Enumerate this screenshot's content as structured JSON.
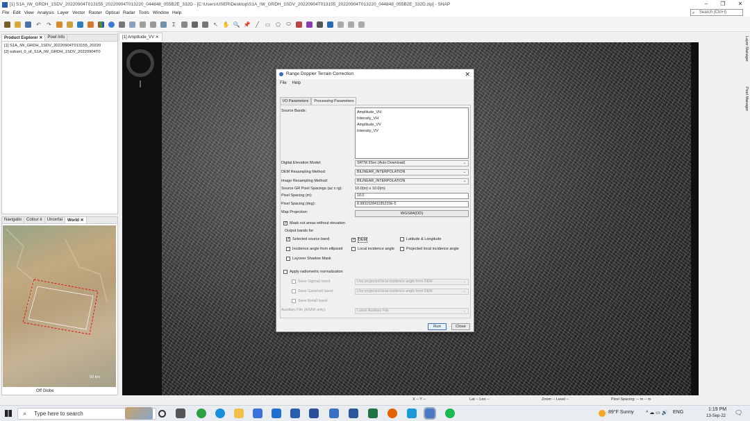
{
  "window": {
    "title": "[1] S1A_IW_GRDH_1SDV_20220904T013155_20220904T013220_044848_055B2E_332D - [C:\\Users\\USER\\Desktop\\S1A_IW_GRDH_1SDV_20220904T013155_20220904T013220_044848_055B2E_332D.zip] - SNAP"
  },
  "menu": [
    "File",
    "Edit",
    "View",
    "Analysis",
    "Layer",
    "Vector",
    "Raster",
    "Optical",
    "Radar",
    "Tools",
    "Window",
    "Help"
  ],
  "search": {
    "placeholder": "Search (Ctrl+I)"
  },
  "product_explorer": {
    "tabs": [
      "Product Explorer",
      "Pixel Info"
    ],
    "items": [
      "[1] S1A_IW_GRDH_1SDV_20220904T013155_20220",
      "[2] subset_0_of_S1A_IW_GRDH_1SDV_20220904T0"
    ]
  },
  "nav_panel": {
    "tabs": [
      "Navigatio",
      "Colour é",
      "Uncertai",
      "World"
    ],
    "footer": "Off Globe",
    "scale": "50 km"
  },
  "document_tab": {
    "label": "[1] Amplitude_VV"
  },
  "dialog": {
    "title": "Range Doppler Terrain Correction",
    "menu": [
      "File",
      "Help"
    ],
    "tabs": [
      "I/O Parameters",
      "Processing Parameters"
    ],
    "source_bands_label": "Source Bands:",
    "source_bands": [
      "Amplitude_VH",
      "Intensity_VH",
      "Amplitude_VV",
      "Intensity_VV"
    ],
    "dem_label": "Digital Elevation Model:",
    "dem_value": "SRTM 3Sec (Auto Download)",
    "dem_resampling_label": "DEM Resampling Method:",
    "dem_resampling_value": "BILINEAR_INTERPOLATION",
    "img_resampling_label": "Image Resampling Method:",
    "img_resampling_value": "BILINEAR_INTERPOLATION",
    "src_spacing_label": "Source GR Pixel Spacings (az x rg):",
    "src_spacing_value": "10.0(m) x 10.0(m)",
    "pixel_spacing_m_label": "Pixel Spacing (m):",
    "pixel_spacing_m_value": "10.0",
    "pixel_spacing_deg_label": "Pixel Spacing (deg):",
    "pixel_spacing_deg_value": "8.983152841195215E-5",
    "map_projection_label": "Map Projection:",
    "map_projection_value": "WGS84(DD)",
    "mask_label": "Mask out areas without elevation",
    "output_bands_label": "Output bands for:",
    "cb_selected_source": "Selected source band",
    "cb_dem": "DEM",
    "cb_latlon": "Latitude & Longitude",
    "cb_incidence_ellipsoid": "Incidence angle from ellipsoid",
    "cb_local_incidence": "Local incidence angle",
    "cb_projected_local": "Projected local incidence angle",
    "cb_layover": "Layover Shadow Mask",
    "cb_radiometric": "Apply radiometric normalization",
    "cb_sigma0": "Save Sigma0 band",
    "cb_gamma0": "Save Gamma0 band",
    "cb_beta0": "Save Beta0 band",
    "sigma0_combo": "Use projected local incidence angle from DEM",
    "gamma0_combo": "Use projected local incidence angle from DEM",
    "aux_label": "Auxiliary File (ASAR only):",
    "aux_value": "Latest Auxiliary File",
    "run": "Run",
    "close": "Close"
  },
  "status": {
    "xy": "X -- Y --",
    "latlon": "Lat -- Lon --",
    "zoom": "Zoom -- Level --",
    "spacing": "Pixel Spacing: -- m -- m"
  },
  "side_tabs": [
    "Layer Manager",
    "Pixel Manager"
  ],
  "taskbar": {
    "search_placeholder": "Type here to search",
    "weather": "89°F  Sunny",
    "lang": "ENG",
    "time": "1:19 PM",
    "date": "13-Sep-22"
  }
}
